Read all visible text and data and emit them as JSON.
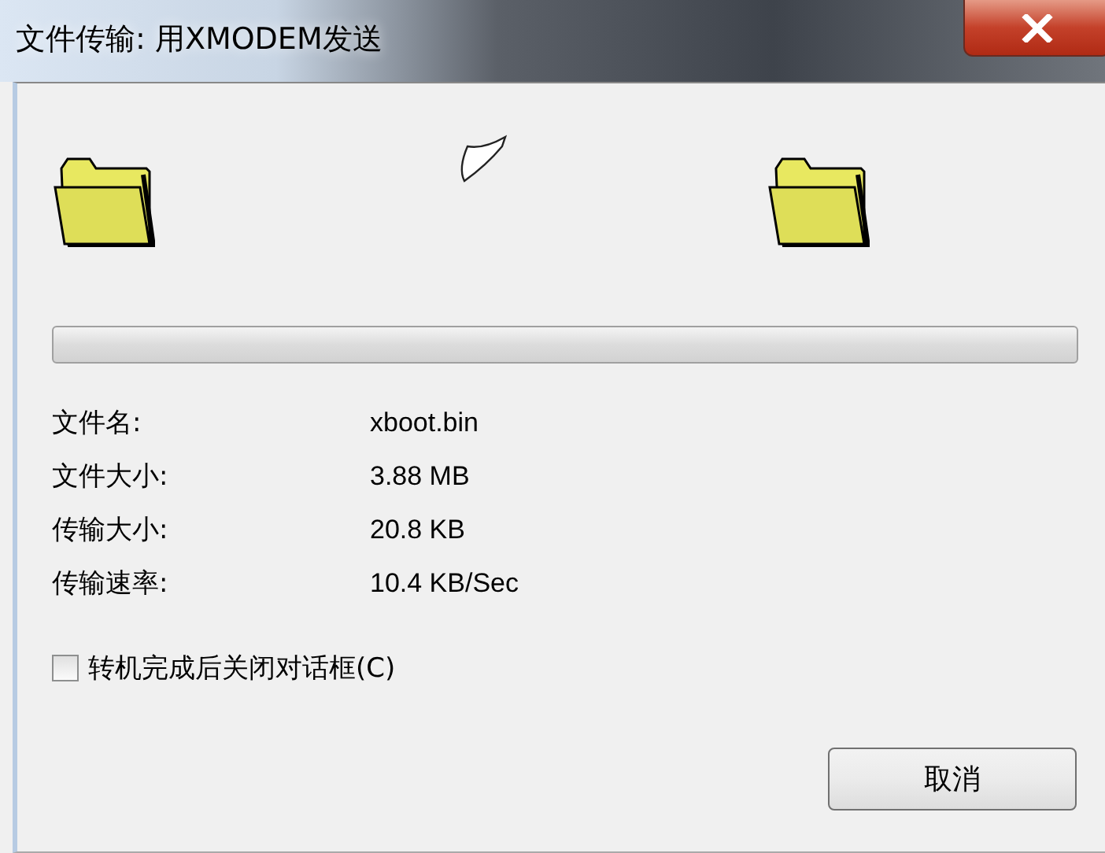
{
  "window": {
    "title": "文件传输: 用XMODEM发送"
  },
  "progress": {
    "level": 0
  },
  "info": [
    {
      "label": "文件名:",
      "value": "xboot.bin"
    },
    {
      "label": "文件大小:",
      "value": "3.88 MB"
    },
    {
      "label": "传输大小:",
      "value": "20.8 KB"
    },
    {
      "label": "传输速率:",
      "value": "10.4 KB/Sec"
    }
  ],
  "close_when_done": {
    "label": "转机完成后关闭对话框(C)",
    "checked": false
  },
  "buttons": [
    "取消"
  ]
}
